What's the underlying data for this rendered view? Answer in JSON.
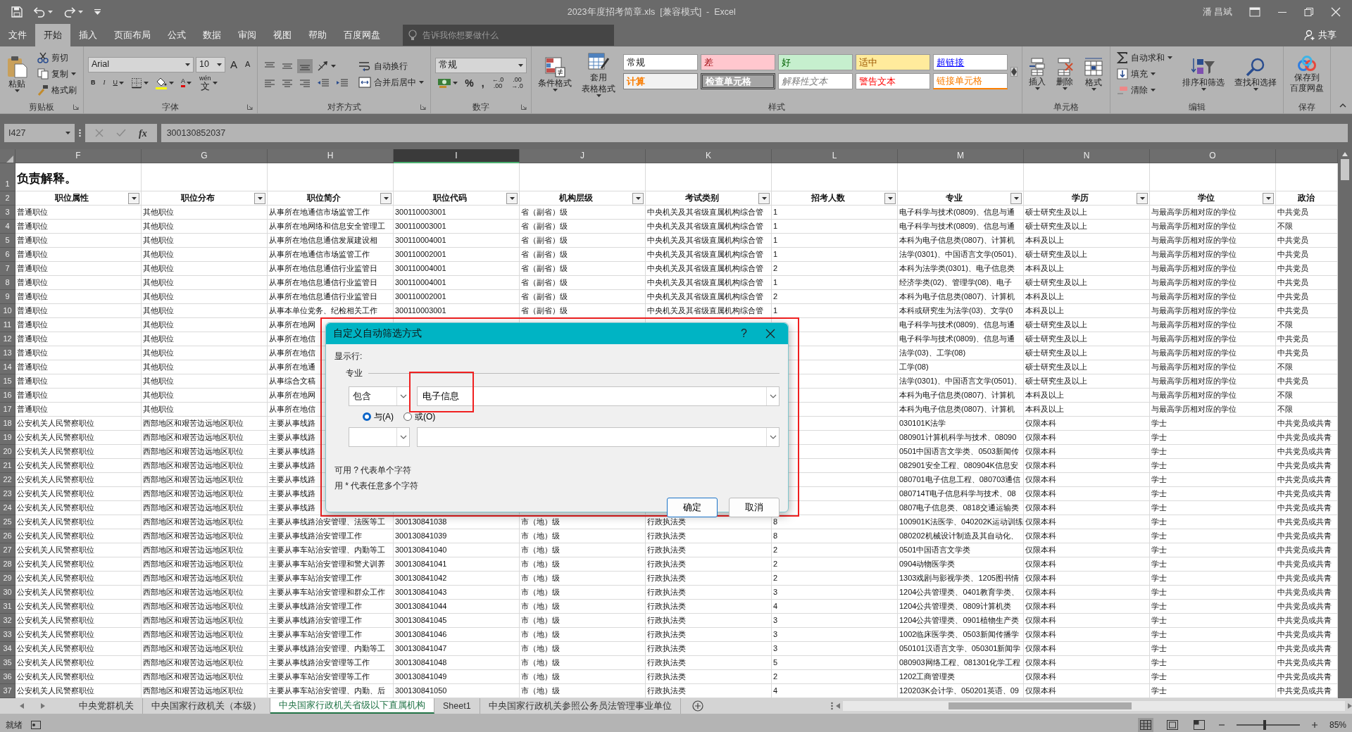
{
  "title_bar": {
    "title": "2023年度招考简章.xls  [兼容模式]  -  Excel",
    "user": "潘 昌斌"
  },
  "ribbon_tabs": [
    {
      "label": "文件",
      "selected": false
    },
    {
      "label": "开始",
      "selected": true
    },
    {
      "label": "插入",
      "selected": false
    },
    {
      "label": "页面布局",
      "selected": false
    },
    {
      "label": "公式",
      "selected": false
    },
    {
      "label": "数据",
      "selected": false
    },
    {
      "label": "审阅",
      "selected": false
    },
    {
      "label": "视图",
      "selected": false
    },
    {
      "label": "帮助",
      "selected": false
    },
    {
      "label": "百度网盘",
      "selected": false
    }
  ],
  "tell_me": {
    "placeholder": "告诉我你想要做什么"
  },
  "share": {
    "label": "共享"
  },
  "ribbon_groups": [
    {
      "label": "剪贴板",
      "launcher": true,
      "columns": [
        [
          [
            {
              "kind": "large",
              "label": "粘贴",
              "dropdown": true
            }
          ]
        ],
        [
          [
            {
              "kind": "small",
              "label": "剪切"
            }
          ],
          [
            {
              "kind": "small",
              "label": "复制",
              "dropdown": true
            }
          ],
          [
            {
              "kind": "small",
              "label": "格式刷"
            }
          ]
        ]
      ]
    },
    {
      "label": "字体",
      "launcher": true,
      "columns": [
        [
          [
            {
              "kind": "field",
              "value": "Arial"
            },
            {
              "kind": "field",
              "value": "10"
            },
            {
              "kind": "glyph",
              "text": "A"
            },
            {
              "kind": "glyph",
              "text": "A"
            }
          ],
          [
            {
              "kind": "glyph",
              "text": "B"
            },
            {
              "kind": "glyph",
              "text": "I"
            },
            {
              "kind": "glyph",
              "text": "U",
              "dropdown": true
            },
            {
              "kind": "tool",
              "pressed": false,
              "dropdown": true
            },
            {
              "kind": "tool",
              "pressed": false,
              "dropdown": true
            },
            {
              "kind": "glyph",
              "text": "A",
              "dropdown": true
            },
            {
              "kind": "glyph",
              "text": "文",
              "top": "wén",
              "dropdown": true
            }
          ]
        ]
      ]
    },
    {
      "label": "对齐方式",
      "launcher": true,
      "columns": [
        [
          [
            {
              "kind": "tool",
              "pressed": false
            },
            {
              "kind": "tool",
              "pressed": false
            },
            {
              "kind": "tool",
              "pressed": true
            },
            {
              "kind": "tool",
              "pressed": false,
              "dropdown": true
            }
          ],
          [
            {
              "kind": "tool",
              "pressed": false
            },
            {
              "kind": "tool",
              "pressed": false
            },
            {
              "kind": "tool",
              "pressed": false
            },
            {
              "kind": "tool",
              "pressed": false
            },
            {
              "kind": "tool",
              "pressed": false
            }
          ]
        ],
        [
          [
            {
              "kind": "small",
              "label": "自动换行"
            }
          ],
          [
            {
              "kind": "small",
              "label": "合并后居中",
              "dropdown": true
            }
          ]
        ]
      ]
    },
    {
      "label": "数字",
      "launcher": true,
      "columns": [
        [
          [
            {
              "kind": "field",
              "value": "常规"
            }
          ],
          [
            {
              "kind": "tool",
              "pressed": false,
              "dropdown": true
            },
            {
              "kind": "glyph",
              "text": "%"
            },
            {
              "kind": "glyph",
              "text": ","
            },
            {
              "kind": "glyph",
              "text": ".00",
              "top": "←.0"
            },
            {
              "kind": "glyph",
              "text": "→.0",
              "top": ".00"
            }
          ]
        ]
      ]
    },
    {
      "label": "样式",
      "launcher": false,
      "columns": [
        [
          [
            {
              "kind": "large",
              "label": "条件格式",
              "dropdown": true
            }
          ]
        ],
        [
          [
            {
              "kind": "large",
              "label": "套用",
              "label2": "表格格式",
              "dropdown": true
            }
          ]
        ],
        [
          [
            {
              "kind": "style",
              "label": "常规"
            },
            {
              "kind": "style",
              "label": "差"
            },
            {
              "kind": "style",
              "label": "好"
            },
            {
              "kind": "style",
              "label": "适中"
            },
            {
              "kind": "style",
              "label": "超链接"
            }
          ],
          [
            {
              "kind": "style",
              "label": "计算"
            },
            {
              "kind": "style",
              "label": "检查单元格"
            },
            {
              "kind": "style",
              "label": "解释性文本"
            },
            {
              "kind": "style",
              "label": "警告文本"
            },
            {
              "kind": "style",
              "label": "链接单元格"
            }
          ]
        ]
      ]
    },
    {
      "label": "单元格",
      "launcher": false,
      "columns": [
        [
          [
            {
              "kind": "large",
              "label": "插入",
              "dropdown": true
            }
          ]
        ],
        [
          [
            {
              "kind": "large",
              "label": "删除",
              "dropdown": true
            }
          ]
        ],
        [
          [
            {
              "kind": "large",
              "label": "格式",
              "dropdown": true
            }
          ]
        ]
      ]
    },
    {
      "label": "编辑",
      "launcher": false,
      "columns": [
        [
          [
            {
              "kind": "small",
              "label": "自动求和",
              "dropdown": true
            }
          ],
          [
            {
              "kind": "small",
              "label": "填充",
              "dropdown": true
            }
          ],
          [
            {
              "kind": "small",
              "label": "清除",
              "dropdown": true
            }
          ]
        ],
        [
          [
            {
              "kind": "large",
              "label": "排序和筛选",
              "dropdown": true
            }
          ]
        ],
        [
          [
            {
              "kind": "large",
              "label": "查找和选择",
              "dropdown": true
            }
          ]
        ]
      ]
    },
    {
      "label": "保存",
      "launcher": false,
      "columns": [
        [
          [
            {
              "kind": "large",
              "label": "保存到",
              "label2": "百度网盘"
            }
          ]
        ]
      ]
    }
  ],
  "formula_bar": {
    "name_box": "I427",
    "function_label": "fx",
    "formula": "300130852037"
  },
  "sheet": {
    "title_row": {
      "number": "1",
      "text": "负责解释。"
    },
    "header_row_number": "2",
    "columns": [
      {
        "letter": "F",
        "header": "职位属性",
        "filter": true,
        "selected": false
      },
      {
        "letter": "G",
        "header": "职位分布",
        "filter": true,
        "selected": false
      },
      {
        "letter": "H",
        "header": "职位简介",
        "filter": true,
        "selected": false
      },
      {
        "letter": "I",
        "header": "职位代码",
        "filter": true,
        "selected": true
      },
      {
        "letter": "J",
        "header": "机构层级",
        "filter": true,
        "selected": false
      },
      {
        "letter": "K",
        "header": "考试类别",
        "filter": true,
        "selected": false
      },
      {
        "letter": "L",
        "header": "招考人数",
        "filter": true,
        "selected": false
      },
      {
        "letter": "M",
        "header": "专业",
        "filter": true,
        "selected": false
      },
      {
        "letter": "N",
        "header": "学历",
        "filter": true,
        "selected": false
      },
      {
        "letter": "O",
        "header": "学位",
        "filter": true,
        "selected": false
      },
      {
        "header": "政治",
        "filter": false,
        "selected": false
      }
    ],
    "rows": [
      {
        "number": "3",
        "cells": [
          "普通职位",
          "其他职位",
          "从事所在地通信市场监管工作",
          "300110003001",
          "省（副省）级",
          "中央机关及其省级直属机构综合管",
          "1",
          "电子科学与技术(0809)、信息与通",
          "硕士研究生及以上",
          "与最高学历相对应的学位",
          "中共党员"
        ]
      },
      {
        "number": "4",
        "cells": [
          "普通职位",
          "其他职位",
          "从事所在地网络和信息安全管理工",
          "300110003001",
          "省（副省）级",
          "中央机关及其省级直属机构综合管",
          "1",
          "电子科学与技术(0809)、信息与通",
          "硕士研究生及以上",
          "与最高学历相对应的学位",
          "不限"
        ]
      },
      {
        "number": "5",
        "cells": [
          "普通职位",
          "其他职位",
          "从事所在地信息通信发展建设相",
          "300110004001",
          "省（副省）级",
          "中央机关及其省级直属机构综合管",
          "1",
          "本科为电子信息类(0807)、计算机",
          "本科及以上",
          "与最高学历相对应的学位",
          "中共党员"
        ]
      },
      {
        "number": "6",
        "cells": [
          "普通职位",
          "其他职位",
          "从事所在地通信市场监管工作",
          "300110002001",
          "省（副省）级",
          "中央机关及其省级直属机构综合管",
          "1",
          "法学(0301)、中国语言文学(0501)、",
          "硕士研究生及以上",
          "与最高学历相对应的学位",
          "中共党员"
        ]
      },
      {
        "number": "7",
        "cells": [
          "普通职位",
          "其他职位",
          "从事所在地信息通信行业监管日",
          "300110004001",
          "省（副省）级",
          "中央机关及其省级直属机构综合管",
          "2",
          "本科为法学类(0301)、电子信息类",
          "本科及以上",
          "与最高学历相对应的学位",
          "中共党员"
        ]
      },
      {
        "number": "8",
        "cells": [
          "普通职位",
          "其他职位",
          "从事所在地信息通信行业监管日",
          "300110004001",
          "省（副省）级",
          "中央机关及其省级直属机构综合管",
          "1",
          "经济学类(02)、管理学(08)、电子",
          "硕士研究生及以上",
          "与最高学历相对应的学位",
          "中共党员"
        ]
      },
      {
        "number": "9",
        "cells": [
          "普通职位",
          "其他职位",
          "从事所在地信息通信行业监管日",
          "300110002001",
          "省（副省）级",
          "中央机关及其省级直属机构综合管",
          "2",
          "本科为电子信息类(0807)、计算机",
          "本科及以上",
          "与最高学历相对应的学位",
          "中共党员"
        ]
      },
      {
        "number": "10",
        "cells": [
          "普通职位",
          "其他职位",
          "从事本单位党务、纪检相关工作",
          "300110003001",
          "省（副省）级",
          "中央机关及其省级直属机构综合管",
          "1",
          "本科或研究生为法学(03)、文学(0",
          "本科及以上",
          "与最高学历相对应的学位",
          "中共党员"
        ]
      },
      {
        "number": "11",
        "cells": [
          "普通职位",
          "其他职位",
          "从事所在地网",
          null,
          null,
          null,
          null,
          "电子科学与技术(0809)、信息与通",
          "硕士研究生及以上",
          "与最高学历相对应的学位",
          "不限"
        ]
      },
      {
        "number": "12",
        "cells": [
          "普通职位",
          "其他职位",
          "从事所在地信",
          null,
          null,
          null,
          null,
          "电子科学与技术(0809)、信息与通",
          "硕士研究生及以上",
          "与最高学历相对应的学位",
          "中共党员"
        ]
      },
      {
        "number": "13",
        "cells": [
          "普通职位",
          "其他职位",
          "从事所在地信",
          null,
          null,
          null,
          null,
          "法学(03)、工学(08)",
          "硕士研究生及以上",
          "与最高学历相对应的学位",
          "中共党员"
        ]
      },
      {
        "number": "14",
        "cells": [
          "普通职位",
          "其他职位",
          "从事所在地通",
          null,
          null,
          null,
          null,
          "工学(08)",
          "硕士研究生及以上",
          "与最高学历相对应的学位",
          "不限"
        ]
      },
      {
        "number": "15",
        "cells": [
          "普通职位",
          "其他职位",
          "从事综合文稿",
          null,
          null,
          null,
          null,
          "法学(0301)、中国语言文学(0501)、",
          "硕士研究生及以上",
          "与最高学历相对应的学位",
          "中共党员"
        ]
      },
      {
        "number": "16",
        "cells": [
          "普通职位",
          "其他职位",
          "从事所在地网",
          null,
          null,
          null,
          null,
          "本科为电子信息类(0807)、计算机",
          "本科及以上",
          "与最高学历相对应的学位",
          "不限"
        ]
      },
      {
        "number": "17",
        "cells": [
          "普通职位",
          "其他职位",
          "从事所在地信",
          null,
          null,
          null,
          null,
          "本科为电子信息类(0807)、计算机",
          "本科及以上",
          "与最高学历相对应的学位",
          "不限"
        ]
      },
      {
        "number": "18",
        "cells": [
          "公安机关人民警察职位",
          "西部地区和艰苦边远地区职位",
          "主要从事线路",
          null,
          null,
          null,
          null,
          "030101K法学",
          "仅限本科",
          "学士",
          "中共党员或共青"
        ]
      },
      {
        "number": "19",
        "cells": [
          "公安机关人民警察职位",
          "西部地区和艰苦边远地区职位",
          "主要从事线路",
          null,
          null,
          null,
          null,
          "080901计算机科学与技术、08090",
          "仅限本科",
          "学士",
          "中共党员或共青"
        ]
      },
      {
        "number": "20",
        "cells": [
          "公安机关人民警察职位",
          "西部地区和艰苦边远地区职位",
          "主要从事线路",
          null,
          null,
          null,
          null,
          "0501中国语言文学类、0503新闻传",
          "仅限本科",
          "学士",
          "中共党员或共青"
        ]
      },
      {
        "number": "21",
        "cells": [
          "公安机关人民警察职位",
          "西部地区和艰苦边远地区职位",
          "主要从事线路",
          null,
          null,
          null,
          null,
          "082901安全工程、080904K信息安",
          "仅限本科",
          "学士",
          "中共党员或共青"
        ]
      },
      {
        "number": "22",
        "cells": [
          "公安机关人民警察职位",
          "西部地区和艰苦边远地区职位",
          "主要从事线路",
          null,
          null,
          null,
          null,
          "080701电子信息工程、080703通信",
          "仅限本科",
          "学士",
          "中共党员或共青"
        ]
      },
      {
        "number": "23",
        "cells": [
          "公安机关人民警察职位",
          "西部地区和艰苦边远地区职位",
          "主要从事线路",
          null,
          null,
          null,
          null,
          "080714T电子信息科学与技术、08",
          "仅限本科",
          "学士",
          "中共党员或共青"
        ]
      },
      {
        "number": "24",
        "cells": [
          "公安机关人民警察职位",
          "西部地区和艰苦边远地区职位",
          "主要从事线路",
          null,
          null,
          null,
          null,
          "0807电子信息类、0818交通运输类",
          "仅限本科",
          "学士",
          "中共党员或共青"
        ]
      },
      {
        "number": "25",
        "cells": [
          "公安机关人民警察职位",
          "西部地区和艰苦边远地区职位",
          "主要从事线路治安管理、法医等工",
          "300130841038",
          "市（地）级",
          "行政执法类",
          "8",
          "100901K法医学、040202K运动训练",
          "仅限本科",
          "学士",
          "中共党员或共青"
        ]
      },
      {
        "number": "26",
        "cells": [
          "公安机关人民警察职位",
          "西部地区和艰苦边远地区职位",
          "主要从事线路治安管理工作",
          "300130841039",
          "市（地）级",
          "行政执法类",
          "8",
          "080202机械设计制造及其自动化、",
          "仅限本科",
          "学士",
          "中共党员或共青"
        ]
      },
      {
        "number": "27",
        "cells": [
          "公安机关人民警察职位",
          "西部地区和艰苦边远地区职位",
          "主要从事车站治安管理、内勤等工",
          "300130841040",
          "市（地）级",
          "行政执法类",
          "2",
          "0501中国语言文学类",
          "仅限本科",
          "学士",
          "中共党员或共青"
        ]
      },
      {
        "number": "28",
        "cells": [
          "公安机关人民警察职位",
          "西部地区和艰苦边远地区职位",
          "主要从事车站治安管理和警犬训养",
          "300130841041",
          "市（地）级",
          "行政执法类",
          "2",
          "0904动物医学类",
          "仅限本科",
          "学士",
          "中共党员或共青"
        ]
      },
      {
        "number": "29",
        "cells": [
          "公安机关人民警察职位",
          "西部地区和艰苦边远地区职位",
          "主要从事车站治安管理工作",
          "300130841042",
          "市（地）级",
          "行政执法类",
          "2",
          "1303戏剧与影视学类、1205图书情",
          "仅限本科",
          "学士",
          "中共党员或共青"
        ]
      },
      {
        "number": "30",
        "cells": [
          "公安机关人民警察职位",
          "西部地区和艰苦边远地区职位",
          "主要从事车站治安管理和群众工作",
          "300130841043",
          "市（地）级",
          "行政执法类",
          "3",
          "1204公共管理类、0401教育学类、",
          "仅限本科",
          "学士",
          "中共党员或共青"
        ]
      },
      {
        "number": "31",
        "cells": [
          "公安机关人民警察职位",
          "西部地区和艰苦边远地区职位",
          "主要从事线路治安管理工作",
          "300130841044",
          "市（地）级",
          "行政执法类",
          "4",
          "1204公共管理类、0809计算机类",
          "仅限本科",
          "学士",
          "中共党员或共青"
        ]
      },
      {
        "number": "32",
        "cells": [
          "公安机关人民警察职位",
          "西部地区和艰苦边远地区职位",
          "主要从事线路治安管理工作",
          "300130841045",
          "市（地）级",
          "行政执法类",
          "3",
          "1204公共管理类、0901植物生产类",
          "仅限本科",
          "学士",
          "中共党员或共青"
        ]
      },
      {
        "number": "33",
        "cells": [
          "公安机关人民警察职位",
          "西部地区和艰苦边远地区职位",
          "主要从事车站治安管理工作",
          "300130841046",
          "市（地）级",
          "行政执法类",
          "3",
          "1002临床医学类、0503新闻传播学",
          "仅限本科",
          "学士",
          "中共党员或共青"
        ]
      },
      {
        "number": "34",
        "cells": [
          "公安机关人民警察职位",
          "西部地区和艰苦边远地区职位",
          "主要从事线路治安管理、内勤等工",
          "300130841047",
          "市（地）级",
          "行政执法类",
          "3",
          "050101汉语言文学、050301新闻学",
          "仅限本科",
          "学士",
          "中共党员或共青"
        ]
      },
      {
        "number": "35",
        "cells": [
          "公安机关人民警察职位",
          "西部地区和艰苦边远地区职位",
          "主要从事线路治安管理等工作",
          "300130841048",
          "市（地）级",
          "行政执法类",
          "5",
          "080903网络工程、081301化学工程",
          "仅限本科",
          "学士",
          "中共党员或共青"
        ]
      },
      {
        "number": "36",
        "cells": [
          "公安机关人民警察职位",
          "西部地区和艰苦边远地区职位",
          "主要从事车站治安管理等工作",
          "300130841049",
          "市（地）级",
          "行政执法类",
          "2",
          "1202工商管理类",
          "仅限本科",
          "学士",
          "中共党员或共青"
        ]
      },
      {
        "number": "37",
        "cells": [
          "公安机关人民警察职位",
          "西部地区和艰苦边远地区职位",
          "主要从事车站治安管理、内勤、后",
          "300130841050",
          "市（地）级",
          "行政执法类",
          "4",
          "120203K会计学、050201英语、09",
          "仅限本科",
          "学士",
          "中共党员或共青"
        ]
      }
    ]
  },
  "dialog": {
    "title": "自定义自动筛选方式",
    "help": "?",
    "show_rows_label": "显示行:",
    "field_label": "专业",
    "conditions": [
      {
        "operator": "包含",
        "value": "电子信息"
      }
    ],
    "join": [
      {
        "label": "与(A)",
        "selected": true
      },
      {
        "label": "或(O)",
        "selected": false
      }
    ],
    "hints": [
      "可用 ? 代表单个字符",
      "用 * 代表任意多个字符"
    ],
    "buttons": [
      {
        "label": "确定",
        "default": true
      },
      {
        "label": "取消",
        "default": false
      }
    ]
  },
  "sheet_tabs": [
    {
      "label": "中央党群机关",
      "selected": false
    },
    {
      "label": "中央国家行政机关（本级）",
      "selected": false
    },
    {
      "label": "中央国家行政机关省级以下直属机构",
      "selected": true
    },
    {
      "label": "Sheet1",
      "selected": false
    },
    {
      "label": "中央国家行政机关参照公务员法管理事业单位",
      "selected": false
    }
  ],
  "status_bar": {
    "text": "就绪",
    "views": [
      {
        "selected": true
      },
      {
        "selected": false
      },
      {
        "selected": false
      }
    ],
    "zoom_slider": {
      "level": 0.45
    },
    "zoom": "85%"
  }
}
